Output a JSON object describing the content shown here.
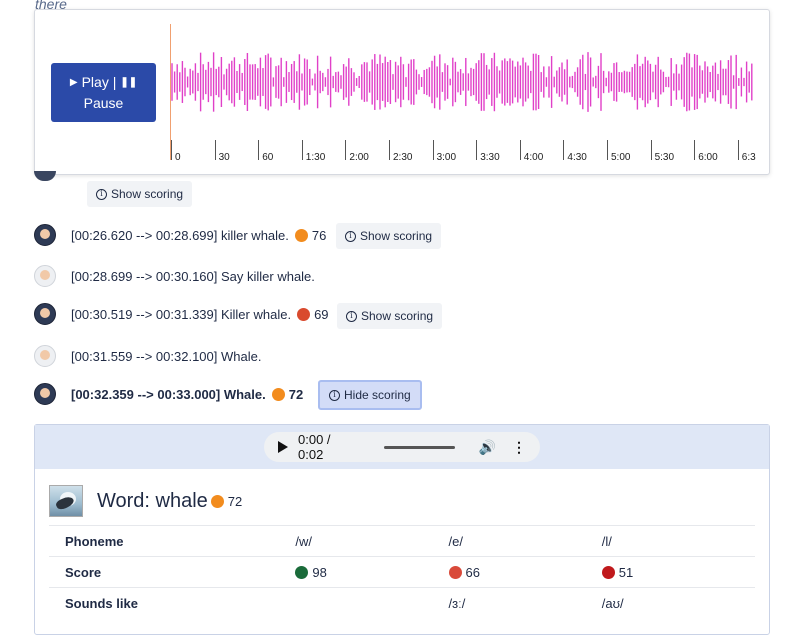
{
  "top_text": "there",
  "player": {
    "play_label": "Play |",
    "pause_label": "Pause",
    "timeline_ticks": [
      "0",
      "30",
      "60",
      "1:30",
      "2:00",
      "2:30",
      "3:00",
      "3:30",
      "4:00",
      "4:30",
      "5:00",
      "5:30",
      "6:00",
      "6:3"
    ],
    "waveform_color": "#e040c8",
    "cursor_color": "#f0a070"
  },
  "transcript": {
    "partial_row_button": "Show scoring",
    "rows": [
      {
        "speaker": "student",
        "text": "[00:26.620 --> 00:28.699] killer whale.",
        "score": "76",
        "score_color": "#f28c1e",
        "button": "Show scoring"
      },
      {
        "speaker": "tutor",
        "text": "[00:28.699 --> 00:30.160] Say killer whale."
      },
      {
        "speaker": "student",
        "text": "[00:30.519 --> 00:31.339] Killer whale.",
        "score": "69",
        "score_color": "#d94a2e",
        "button": "Show scoring"
      },
      {
        "speaker": "tutor",
        "text": "[00:31.559 --> 00:32.100] Whale."
      },
      {
        "speaker": "student",
        "text": "[00:32.359 --> 00:33.000] Whale.",
        "score": "72",
        "score_color": "#f28c1e",
        "button": "Hide scoring",
        "active": true
      }
    ]
  },
  "scoring_panel": {
    "audio": {
      "time": "0:00 / 0:02"
    },
    "word_label": "Word: whale",
    "word_score": "72",
    "word_score_color": "#f28c1e",
    "table": {
      "row_labels": [
        "Phoneme",
        "Score",
        "Sounds like"
      ],
      "phonemes": [
        "/w/",
        "/e/",
        "/l/"
      ],
      "scores": [
        "98",
        "66",
        "51"
      ],
      "score_colors": [
        "#1a6b3a",
        "#d94a3a",
        "#c0191c"
      ],
      "sounds_like": [
        "",
        "/ɜː/",
        "/aʊ/"
      ]
    }
  }
}
